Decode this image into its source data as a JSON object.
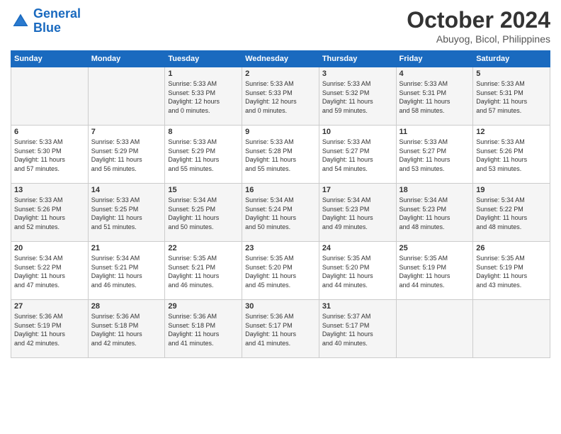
{
  "header": {
    "logo_line1": "General",
    "logo_line2": "Blue",
    "month": "October 2024",
    "location": "Abuyog, Bicol, Philippines"
  },
  "weekdays": [
    "Sunday",
    "Monday",
    "Tuesday",
    "Wednesday",
    "Thursday",
    "Friday",
    "Saturday"
  ],
  "weeks": [
    [
      {
        "day": "",
        "info": ""
      },
      {
        "day": "",
        "info": ""
      },
      {
        "day": "1",
        "info": "Sunrise: 5:33 AM\nSunset: 5:33 PM\nDaylight: 12 hours\nand 0 minutes."
      },
      {
        "day": "2",
        "info": "Sunrise: 5:33 AM\nSunset: 5:33 PM\nDaylight: 12 hours\nand 0 minutes."
      },
      {
        "day": "3",
        "info": "Sunrise: 5:33 AM\nSunset: 5:32 PM\nDaylight: 11 hours\nand 59 minutes."
      },
      {
        "day": "4",
        "info": "Sunrise: 5:33 AM\nSunset: 5:31 PM\nDaylight: 11 hours\nand 58 minutes."
      },
      {
        "day": "5",
        "info": "Sunrise: 5:33 AM\nSunset: 5:31 PM\nDaylight: 11 hours\nand 57 minutes."
      }
    ],
    [
      {
        "day": "6",
        "info": "Sunrise: 5:33 AM\nSunset: 5:30 PM\nDaylight: 11 hours\nand 57 minutes."
      },
      {
        "day": "7",
        "info": "Sunrise: 5:33 AM\nSunset: 5:29 PM\nDaylight: 11 hours\nand 56 minutes."
      },
      {
        "day": "8",
        "info": "Sunrise: 5:33 AM\nSunset: 5:29 PM\nDaylight: 11 hours\nand 55 minutes."
      },
      {
        "day": "9",
        "info": "Sunrise: 5:33 AM\nSunset: 5:28 PM\nDaylight: 11 hours\nand 55 minutes."
      },
      {
        "day": "10",
        "info": "Sunrise: 5:33 AM\nSunset: 5:27 PM\nDaylight: 11 hours\nand 54 minutes."
      },
      {
        "day": "11",
        "info": "Sunrise: 5:33 AM\nSunset: 5:27 PM\nDaylight: 11 hours\nand 53 minutes."
      },
      {
        "day": "12",
        "info": "Sunrise: 5:33 AM\nSunset: 5:26 PM\nDaylight: 11 hours\nand 53 minutes."
      }
    ],
    [
      {
        "day": "13",
        "info": "Sunrise: 5:33 AM\nSunset: 5:26 PM\nDaylight: 11 hours\nand 52 minutes."
      },
      {
        "day": "14",
        "info": "Sunrise: 5:33 AM\nSunset: 5:25 PM\nDaylight: 11 hours\nand 51 minutes."
      },
      {
        "day": "15",
        "info": "Sunrise: 5:34 AM\nSunset: 5:25 PM\nDaylight: 11 hours\nand 50 minutes."
      },
      {
        "day": "16",
        "info": "Sunrise: 5:34 AM\nSunset: 5:24 PM\nDaylight: 11 hours\nand 50 minutes."
      },
      {
        "day": "17",
        "info": "Sunrise: 5:34 AM\nSunset: 5:23 PM\nDaylight: 11 hours\nand 49 minutes."
      },
      {
        "day": "18",
        "info": "Sunrise: 5:34 AM\nSunset: 5:23 PM\nDaylight: 11 hours\nand 48 minutes."
      },
      {
        "day": "19",
        "info": "Sunrise: 5:34 AM\nSunset: 5:22 PM\nDaylight: 11 hours\nand 48 minutes."
      }
    ],
    [
      {
        "day": "20",
        "info": "Sunrise: 5:34 AM\nSunset: 5:22 PM\nDaylight: 11 hours\nand 47 minutes."
      },
      {
        "day": "21",
        "info": "Sunrise: 5:34 AM\nSunset: 5:21 PM\nDaylight: 11 hours\nand 46 minutes."
      },
      {
        "day": "22",
        "info": "Sunrise: 5:35 AM\nSunset: 5:21 PM\nDaylight: 11 hours\nand 46 minutes."
      },
      {
        "day": "23",
        "info": "Sunrise: 5:35 AM\nSunset: 5:20 PM\nDaylight: 11 hours\nand 45 minutes."
      },
      {
        "day": "24",
        "info": "Sunrise: 5:35 AM\nSunset: 5:20 PM\nDaylight: 11 hours\nand 44 minutes."
      },
      {
        "day": "25",
        "info": "Sunrise: 5:35 AM\nSunset: 5:19 PM\nDaylight: 11 hours\nand 44 minutes."
      },
      {
        "day": "26",
        "info": "Sunrise: 5:35 AM\nSunset: 5:19 PM\nDaylight: 11 hours\nand 43 minutes."
      }
    ],
    [
      {
        "day": "27",
        "info": "Sunrise: 5:36 AM\nSunset: 5:19 PM\nDaylight: 11 hours\nand 42 minutes."
      },
      {
        "day": "28",
        "info": "Sunrise: 5:36 AM\nSunset: 5:18 PM\nDaylight: 11 hours\nand 42 minutes."
      },
      {
        "day": "29",
        "info": "Sunrise: 5:36 AM\nSunset: 5:18 PM\nDaylight: 11 hours\nand 41 minutes."
      },
      {
        "day": "30",
        "info": "Sunrise: 5:36 AM\nSunset: 5:17 PM\nDaylight: 11 hours\nand 41 minutes."
      },
      {
        "day": "31",
        "info": "Sunrise: 5:37 AM\nSunset: 5:17 PM\nDaylight: 11 hours\nand 40 minutes."
      },
      {
        "day": "",
        "info": ""
      },
      {
        "day": "",
        "info": ""
      }
    ]
  ]
}
